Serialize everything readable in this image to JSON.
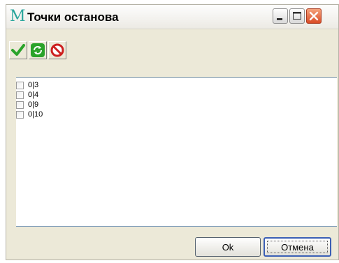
{
  "window": {
    "title": "Точки останова",
    "app_icon_letter": "M"
  },
  "toolbar": {
    "icons": [
      "check-icon",
      "refresh-icon",
      "no-entry-icon"
    ]
  },
  "breakpoints": {
    "items": [
      {
        "label": "0|3",
        "checked": false
      },
      {
        "label": "0|4",
        "checked": false
      },
      {
        "label": "0|9",
        "checked": false
      },
      {
        "label": "0|10",
        "checked": false
      }
    ]
  },
  "buttons": {
    "ok_label": "Ok",
    "cancel_label": "Отмена"
  },
  "colors": {
    "close_button": "#d94b26",
    "check_green": "#2aa32a",
    "no_entry_red": "#cc1f1f"
  }
}
